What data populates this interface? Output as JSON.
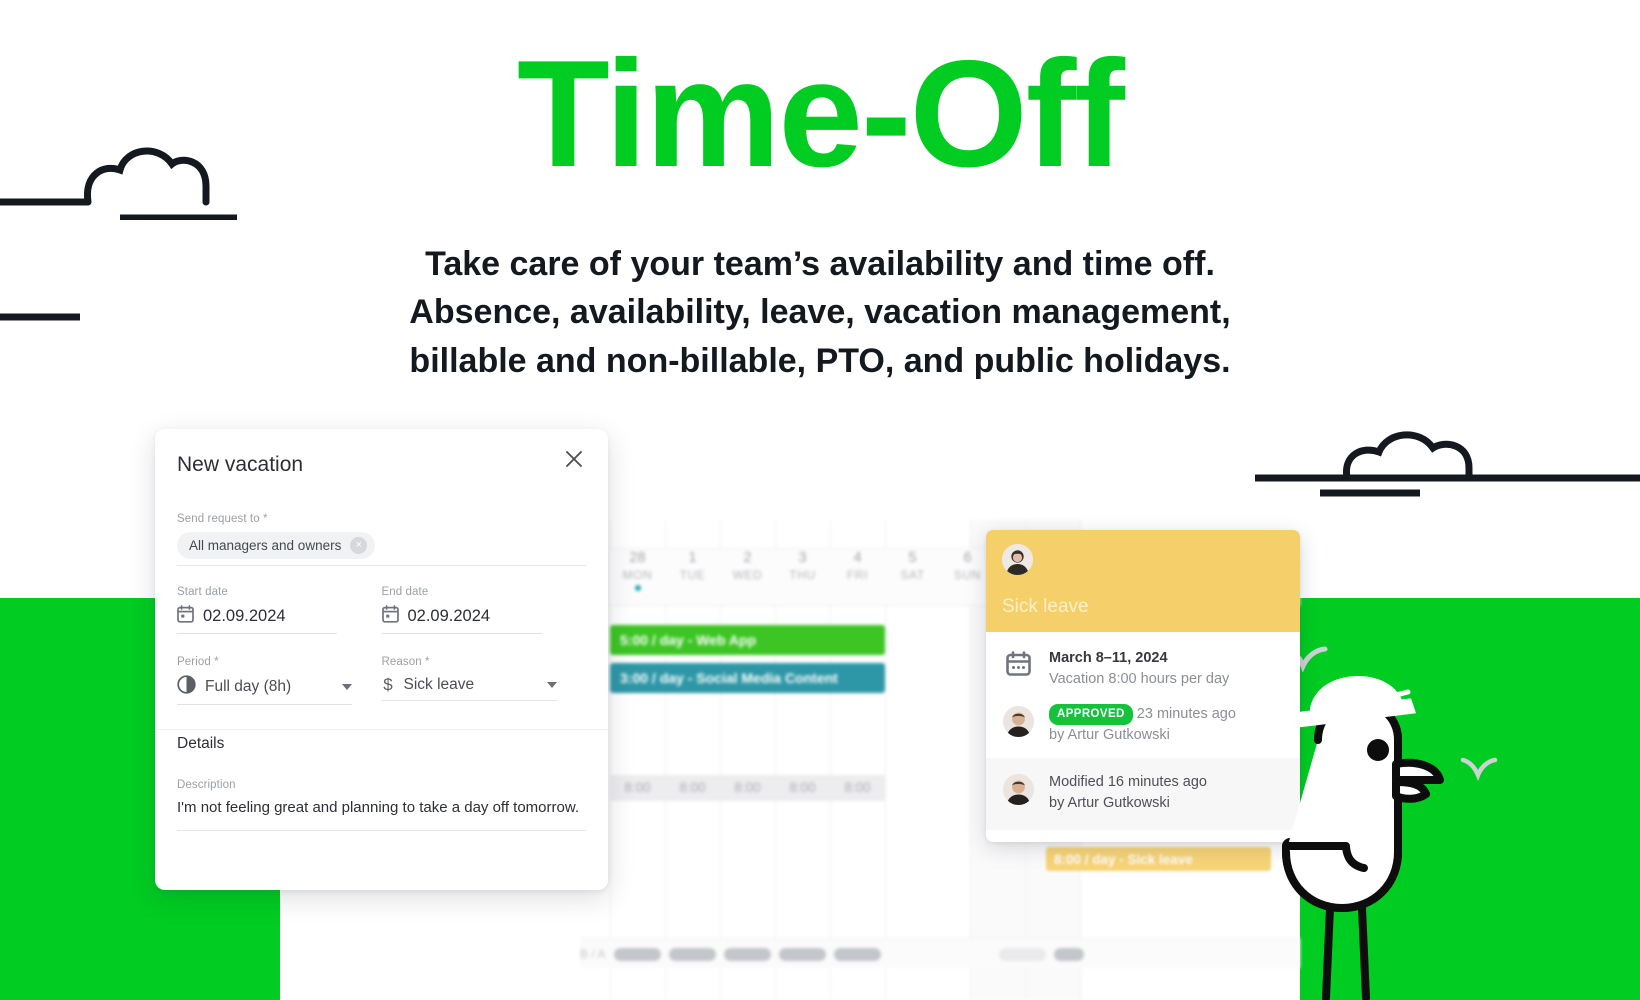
{
  "hero": {
    "title": "Time-Off",
    "subtitle_lines": [
      "Take care of your team’s availability and time off.",
      "Absence, availability, leave, vacation management,",
      "billable and non-billable, PTO, and public holidays."
    ],
    "accent_color": "#00CC22"
  },
  "modal": {
    "title": "New vacation",
    "close_label": "×",
    "send_request": {
      "label": "Send request to *",
      "chip_value": "All managers and owners",
      "chip_remove": "×"
    },
    "start_date": {
      "label": "Start date",
      "value": "02.09.2024",
      "icon": "calendar-icon"
    },
    "end_date": {
      "label": "End date",
      "value": "02.09.2024",
      "icon": "calendar-icon"
    },
    "period": {
      "label": "Period *",
      "value": "Full day (8h)",
      "icon": "half-moon-icon"
    },
    "reason": {
      "label": "Reason *",
      "value": "Sick leave",
      "icon": "dollar-icon"
    },
    "details_heading": "Details",
    "description": {
      "label": "Description",
      "value": "I'm not feeling great and planning to take a day off tomorrow."
    }
  },
  "calendar": {
    "days": [
      {
        "num": "28",
        "name": "MON",
        "today": true
      },
      {
        "num": "1",
        "name": "TUE",
        "today": false
      },
      {
        "num": "2",
        "name": "WED",
        "today": false
      },
      {
        "num": "3",
        "name": "THU",
        "today": false
      },
      {
        "num": "4",
        "name": "FRI",
        "today": false
      },
      {
        "num": "5",
        "name": "SAT",
        "today": false
      },
      {
        "num": "6",
        "name": "SUN",
        "today": false
      }
    ],
    "tasks": [
      {
        "label": "5:00 / day - Web App",
        "color": "#3DC524"
      },
      {
        "label": "3:00 / day - Social Media Content",
        "color": "#2E97A7"
      }
    ],
    "hours_row": [
      "8:00",
      "8:00",
      "8:00",
      "8:00",
      "8:00"
    ],
    "footer_label": "B / A",
    "sick_strip": "8:00 / day - Sick leave"
  },
  "leave_card": {
    "header_title": "Sick leave",
    "header_color": "#F5D06A",
    "date_line": "March 8–11, 2024",
    "date_sub": "Vacation 8:00 hours per day",
    "status_badge": "APPROVED",
    "status_time": "23 minutes ago",
    "status_by": "by Artur Gutkowski",
    "modified_line": "Modified 16 minutes ago",
    "modified_by": "by Artur Gutkowski",
    "badge_color": "#15C23B"
  },
  "decor": {
    "cloud_left": "cloud-outline-icon",
    "cloud_right": "cloud-outline-icon",
    "bird": "seagull-with-sailor-cap-icon",
    "bird_marks": "flying-bird-v-icon"
  }
}
